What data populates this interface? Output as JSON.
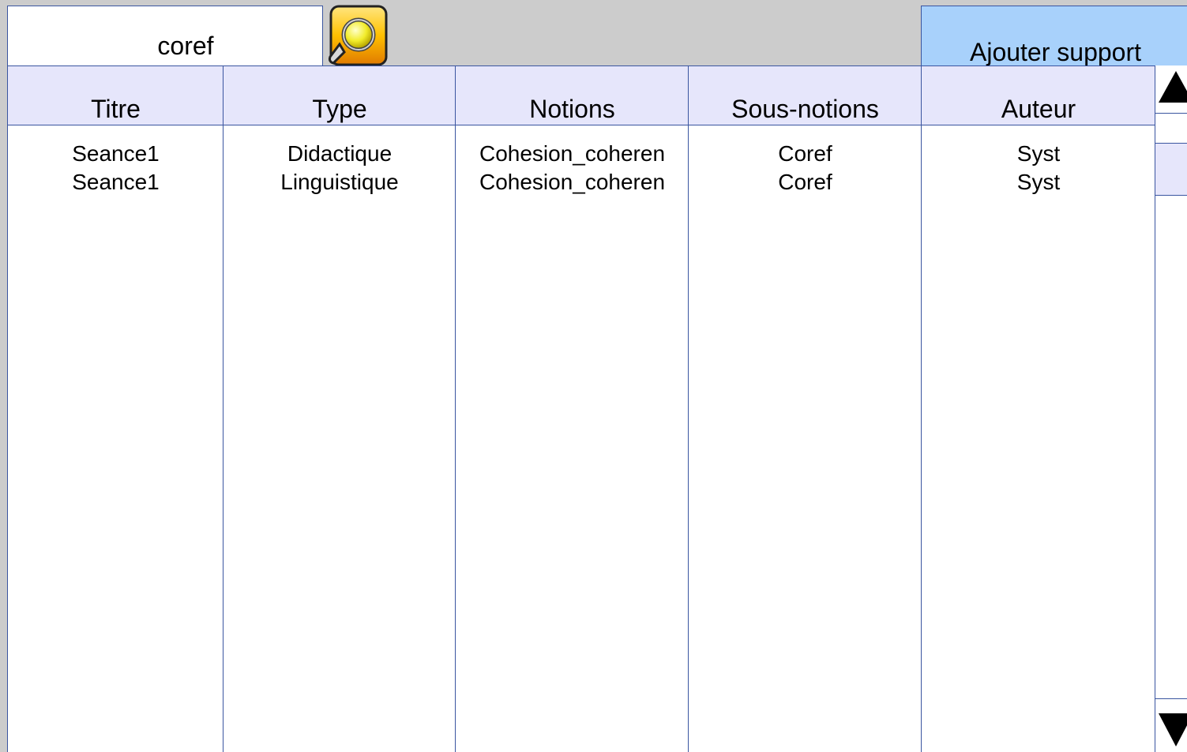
{
  "search": {
    "value": "coref"
  },
  "toolbar": {
    "add_label": "Ajouter support"
  },
  "table": {
    "columns": [
      "Titre",
      "Type",
      "Notions",
      "Sous-notions",
      "Auteur"
    ],
    "rows": [
      [
        "Seance1",
        "Didactique",
        "Cohesion_coheren",
        "Coref",
        "Syst"
      ],
      [
        "Seance1",
        "Linguistique",
        "Cohesion_coheren",
        "Coref",
        "Syst"
      ]
    ]
  },
  "colors": {
    "background": "#cccccc",
    "header_bg": "#e6e6fb",
    "button_bg": "#a8d1fb",
    "border": "#3a55a0"
  },
  "icons": {
    "search": "magnifier-folder-icon",
    "scroll_up": "triangle-up-icon",
    "scroll_down": "triangle-down-icon"
  }
}
